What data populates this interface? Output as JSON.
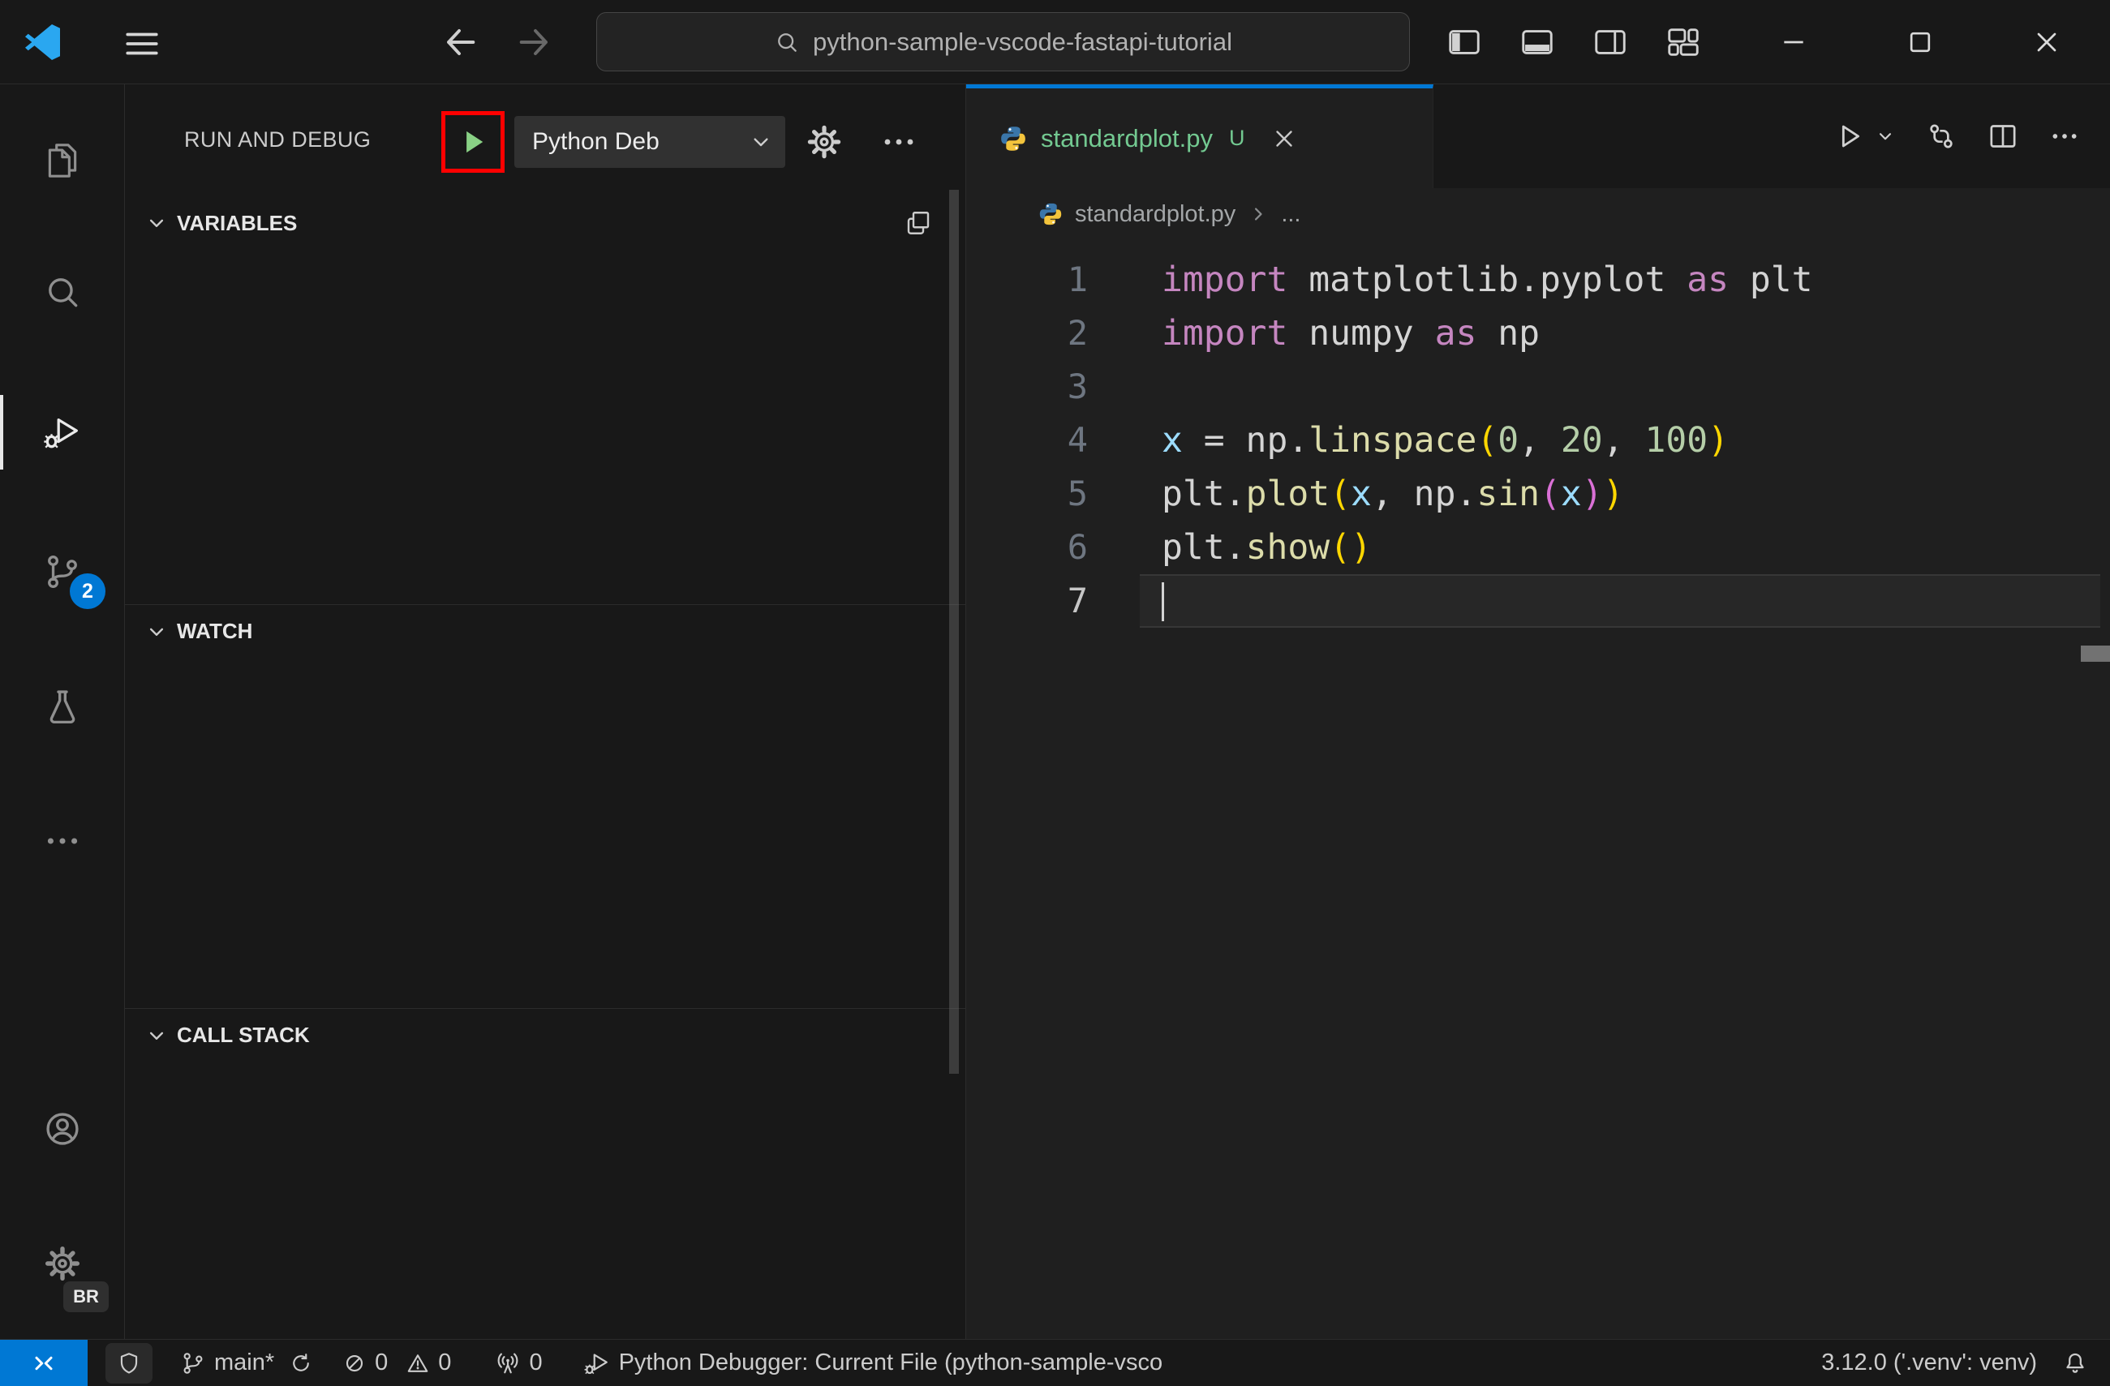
{
  "colors": {
    "accent_blue": "#0078d4",
    "annotation_red": "#ff0000",
    "debug_start_green": "#89d185",
    "untracked_green": "#73c991",
    "editor_bg": "#1f1f1f",
    "shell_bg": "#181818"
  },
  "title_bar": {
    "command_center": {
      "value": "python-sample-vscode-fastapi-tutorial"
    }
  },
  "activity_bar": {
    "scm_badge": "2",
    "profile_badge": "BR"
  },
  "sidebar": {
    "title": "RUN AND DEBUG",
    "config_selector": "Python Deb",
    "sections": [
      {
        "label": "VARIABLES"
      },
      {
        "label": "WATCH"
      },
      {
        "label": "CALL STACK"
      }
    ]
  },
  "editor": {
    "tab": {
      "label": "standardplot.py",
      "git_status": "U"
    },
    "breadcrumb": {
      "file": "standardplot.py",
      "ellipsis": "..."
    },
    "code": {
      "language": "python",
      "lines": [
        {
          "num": 1,
          "tokens": [
            {
              "c": "kw",
              "t": "import"
            },
            {
              "c": "pl",
              "t": " matplotlib.pyplot "
            },
            {
              "c": "kw",
              "t": "as"
            },
            {
              "c": "pl",
              "t": " plt"
            }
          ]
        },
        {
          "num": 2,
          "tokens": [
            {
              "c": "kw",
              "t": "import"
            },
            {
              "c": "pl",
              "t": " numpy "
            },
            {
              "c": "kw",
              "t": "as"
            },
            {
              "c": "pl",
              "t": " np"
            }
          ]
        },
        {
          "num": 3,
          "tokens": []
        },
        {
          "num": 4,
          "tokens": [
            {
              "c": "vr",
              "t": "x"
            },
            {
              "c": "pl",
              "t": " = np."
            },
            {
              "c": "fn",
              "t": "linspace"
            },
            {
              "c": "p1",
              "t": "("
            },
            {
              "c": "nm",
              "t": "0"
            },
            {
              "c": "pl",
              "t": ", "
            },
            {
              "c": "nm",
              "t": "20"
            },
            {
              "c": "pl",
              "t": ", "
            },
            {
              "c": "nm",
              "t": "100"
            },
            {
              "c": "p1",
              "t": ")"
            }
          ]
        },
        {
          "num": 5,
          "tokens": [
            {
              "c": "pl",
              "t": "plt."
            },
            {
              "c": "fn",
              "t": "plot"
            },
            {
              "c": "p1",
              "t": "("
            },
            {
              "c": "vr",
              "t": "x"
            },
            {
              "c": "pl",
              "t": ", np."
            },
            {
              "c": "fn",
              "t": "sin"
            },
            {
              "c": "p2",
              "t": "("
            },
            {
              "c": "vr",
              "t": "x"
            },
            {
              "c": "p2",
              "t": ")"
            },
            {
              "c": "p1",
              "t": ")"
            }
          ]
        },
        {
          "num": 6,
          "tokens": [
            {
              "c": "pl",
              "t": "plt."
            },
            {
              "c": "fn",
              "t": "show"
            },
            {
              "c": "p1",
              "t": "("
            },
            {
              "c": "p1",
              "t": ")"
            }
          ]
        },
        {
          "num": 7,
          "tokens": [],
          "current": true,
          "cursor": true
        }
      ]
    }
  },
  "status_bar": {
    "branch": "main*",
    "errors": "0",
    "warnings": "0",
    "ports": "0",
    "debugger": "Python Debugger: Current File (python-sample-vsco",
    "interpreter": "3.12.0 ('.venv': venv)"
  },
  "icons": {
    "vscode-logo": "blue angular ribbon",
    "menu-icon": "hamburger",
    "search-icon": "magnifier",
    "run-and-debug-icon": "play triangle with bug",
    "source-control-icon": "git branch",
    "testing-icon": "beaker",
    "settings-gear-icon": "gear",
    "remote-icon": "><",
    "bell-icon": "bell"
  }
}
